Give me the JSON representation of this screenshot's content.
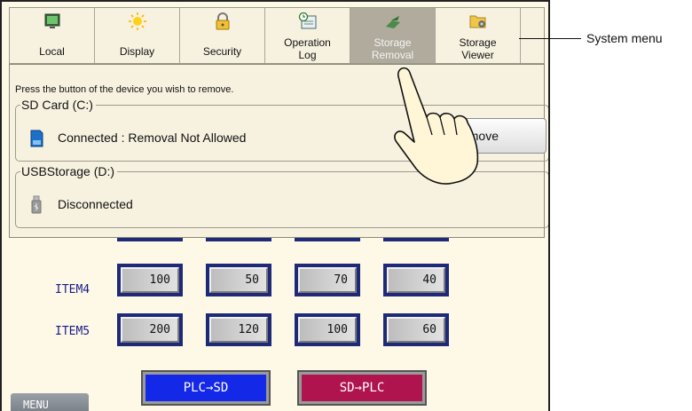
{
  "tabs": [
    {
      "label": "Local",
      "icon": "monitor-icon"
    },
    {
      "label": "Display",
      "icon": "sun-icon"
    },
    {
      "label": "Security",
      "icon": "lock-icon"
    },
    {
      "label": "Operation\nLog",
      "icon": "clock-log-icon"
    },
    {
      "label": "Storage\nRemoval",
      "icon": "storage-eject-icon",
      "active": true
    },
    {
      "label": "Storage\nViewer",
      "icon": "folder-gear-icon"
    }
  ],
  "panel": {
    "instruction": "Press the button of the device you wish to remove.",
    "sd": {
      "title": "SD Card (C:)",
      "status": "Connected : Removal Not Allowed",
      "button": "emove"
    },
    "usb": {
      "title": "USBStorage (D:)",
      "status": "Disconnected"
    }
  },
  "table": {
    "rows": [
      {
        "label": "ITEM4",
        "values": [
          "100",
          "50",
          "70",
          "40"
        ]
      },
      {
        "label": "ITEM5",
        "values": [
          "200",
          "120",
          "100",
          "60"
        ]
      }
    ]
  },
  "buttons": {
    "plc_to_sd": "PLC→SD",
    "sd_to_plc": "SD→PLC",
    "menu": "MENU"
  },
  "callout": "System menu",
  "colors": {
    "panel_bg": "#f7f2e0",
    "active_tab": "#b0ab9d",
    "blue_button": "#1428e8",
    "red_button": "#b0144e",
    "cell_frame": "#1e2a78"
  }
}
